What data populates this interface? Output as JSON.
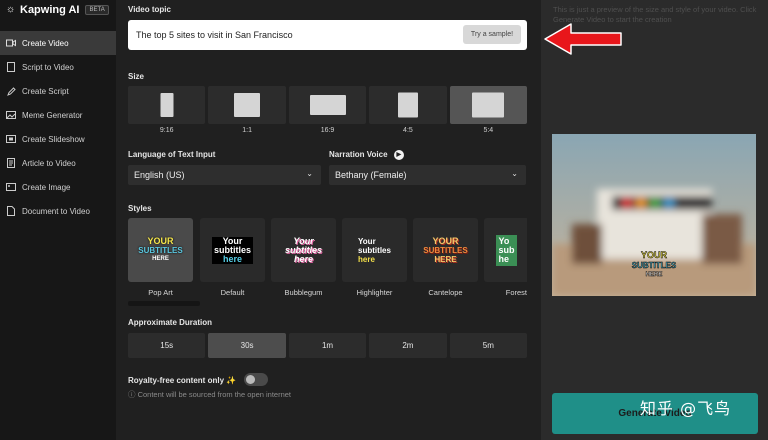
{
  "brand": {
    "name": "Kapwing AI",
    "badge": "BETA"
  },
  "sidebar": {
    "items": [
      {
        "label": "Create Video",
        "icon": "video-camera-icon",
        "active": true
      },
      {
        "label": "Script to Video",
        "icon": "document-icon"
      },
      {
        "label": "Create Script",
        "icon": "pen-icon"
      },
      {
        "label": "Meme Generator",
        "icon": "image-icon"
      },
      {
        "label": "Create Slideshow",
        "icon": "slideshow-icon"
      },
      {
        "label": "Article to Video",
        "icon": "article-icon"
      },
      {
        "label": "Create Image",
        "icon": "image-icon"
      },
      {
        "label": "Document to Video",
        "icon": "document-icon"
      }
    ]
  },
  "topic": {
    "label": "Video topic",
    "value": "The top 5 sites to visit in San Francisco",
    "sample_button": "Try a sample!"
  },
  "size": {
    "label": "Size",
    "options": [
      "9:16",
      "1:1",
      "16:9",
      "4:5",
      "5:4"
    ],
    "selected": "5:4"
  },
  "language": {
    "label": "Language of Text Input",
    "value": "English (US)"
  },
  "voice": {
    "label": "Narration Voice",
    "value": "Bethany (Female)"
  },
  "styles": {
    "label": "Styles",
    "items": [
      {
        "name": "Pop Art",
        "preview": [
          "YOUR",
          "SUBTITLES",
          "HERE"
        ]
      },
      {
        "name": "Default",
        "preview": [
          "Your",
          "subtitles",
          "here"
        ]
      },
      {
        "name": "Bubblegum",
        "preview": [
          "Your",
          "subtitles",
          "here"
        ]
      },
      {
        "name": "Highlighter",
        "preview": [
          "Your",
          "subtitles",
          "here"
        ]
      },
      {
        "name": "Cantelope",
        "preview": [
          "YOUR",
          "SUBTITLES",
          "HERE"
        ]
      },
      {
        "name": "Forest",
        "preview": [
          "Yo",
          "sub",
          "he"
        ]
      }
    ]
  },
  "duration": {
    "label": "Approximate Duration",
    "options": [
      "15s",
      "30s",
      "1m",
      "2m",
      "5m"
    ],
    "selected": "30s"
  },
  "royalty": {
    "label": "Royalty-free content only ✨",
    "hint": "Content will be sourced from the open internet"
  },
  "preview": {
    "note": "This is just a preview of the size and style of your video. Click Generate Video to start the creation",
    "subtitle": [
      "YOUR",
      "SUBTITLES",
      "HERE"
    ],
    "generate": "Generate Video"
  },
  "watermark": "知乎 @飞鸟",
  "colors": {
    "accent": "#1f8f88",
    "arrow": "#e8161b"
  }
}
